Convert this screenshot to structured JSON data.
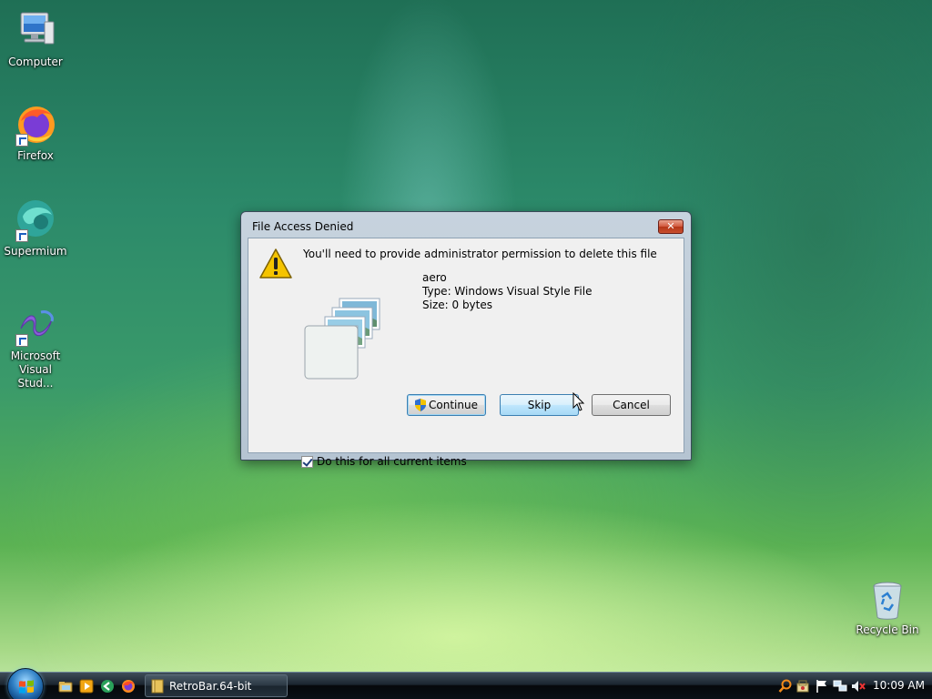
{
  "desktop": {
    "icons": [
      {
        "label_line1": "Computer",
        "label_line2": ""
      },
      {
        "label_line1": "Firefox",
        "label_line2": ""
      },
      {
        "label_line1": "Supermium",
        "label_line2": ""
      },
      {
        "label_line1": "Microsoft",
        "label_line2": "Visual Stud..."
      },
      {
        "label_line1": "Recycle Bin",
        "label_line2": ""
      }
    ]
  },
  "dialog": {
    "title": "File Access Denied",
    "close_glyph": "✕",
    "message": "You'll need to provide administrator permission to delete this file",
    "file_name": "aero",
    "file_type": "Type: Windows Visual Style File",
    "file_size": "Size: 0 bytes",
    "buttons": {
      "continue": "Continue",
      "skip": "Skip",
      "cancel": "Cancel"
    },
    "checkbox_label": "Do this for all current items",
    "checkbox_checked": true
  },
  "taskbar": {
    "quick_launch": [
      "explorer-icon",
      "media-player-icon",
      "back-arrow-icon",
      "firefox-icon"
    ],
    "task_button_label": "RetroBar.64-bit",
    "tray_icons": [
      "search-icon",
      "security-icon",
      "flag-icon",
      "network-icon",
      "volume-muted-icon"
    ],
    "clock": "10:09 AM"
  },
  "colors": {
    "accent": "#3c7fb1",
    "warning": "#f5c400",
    "close": "#c8502f"
  }
}
